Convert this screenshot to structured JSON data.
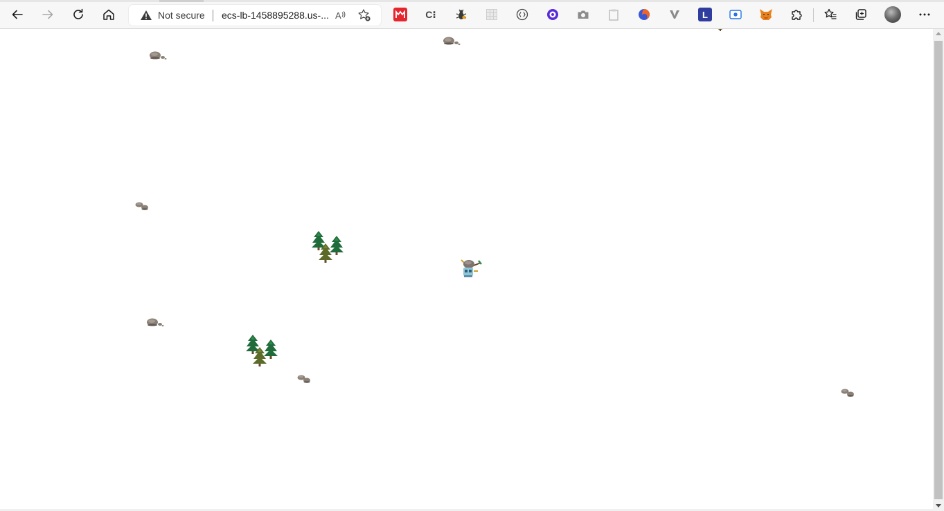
{
  "browser": {
    "security_label": "Not secure",
    "url": "ecs-lb-1458895288.us-...",
    "icons": {
      "back": "arrow-left-icon",
      "forward": "arrow-right-icon",
      "refresh": "refresh-icon",
      "home": "home-icon",
      "security": "warning-triangle-icon",
      "read_aloud": "read-aloud-icon",
      "add_favorite": "star-plus-icon",
      "extensions": "puzzle-piece-icon",
      "favorites": "star-list-icon",
      "collections": "collections-icon",
      "profile": "avatar",
      "menu": "more-dots-icon"
    },
    "extension_icons": [
      "red-m-extension-icon",
      "c-dots-extension-icon",
      "bug-extension-icon",
      "grid-extension-icon",
      "bracket-extension-icon",
      "purple-bot-extension-icon",
      "camera-extension-icon",
      "clipboard-extension-icon",
      "firefox-style-extension-icon",
      "v-extension-icon",
      "l-extension-icon",
      "screen-record-extension-icon",
      "fox-extension-icon"
    ],
    "extension_labels": {
      "c_dots": "C⁝",
      "l": "L"
    }
  },
  "game": {
    "player": "player-character-with-pickaxe",
    "objects": [
      {
        "type": "rock"
      },
      {
        "type": "rock"
      },
      {
        "type": "tree-partial"
      },
      {
        "type": "rock"
      },
      {
        "type": "tree-cluster"
      },
      {
        "type": "player"
      },
      {
        "type": "rock"
      },
      {
        "type": "tree-cluster"
      },
      {
        "type": "rock"
      },
      {
        "type": "rock"
      }
    ]
  },
  "colors": {
    "tree_dark": "#1f6b3a",
    "tree_olive": "#5c6b2a",
    "rock": "#8a7f75",
    "rock_shadow": "#5f5750",
    "warning": "#3b3b3b",
    "extension_red": "#e5262f",
    "extension_purple": "#5a2bd8",
    "extension_navy": "#2f3e9e",
    "extension_blue": "#2673e6",
    "extension_orange": "#e8821e"
  }
}
